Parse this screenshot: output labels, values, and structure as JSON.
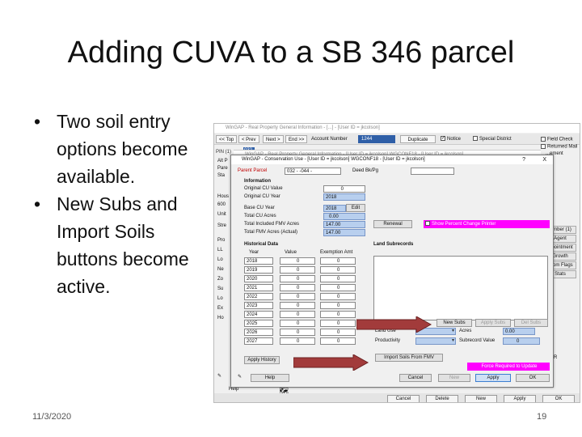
{
  "slide": {
    "title": "Adding CUVA to a SB 346 parcel",
    "bullets": [
      "Two soil entry options become available.",
      "New Subs and Import Soils buttons become active."
    ],
    "date": "11/3/2020",
    "page": "19"
  },
  "background_window": {
    "title": "WinGAP - Real Property General Information - [...] - [User ID = jkcolson]",
    "nav_top": "<< Top",
    "nav_prev": "< Prev",
    "nav_next": "Next >",
    "nav_end": "End >>",
    "account_label": "Account Number",
    "account_value": "1244",
    "duplicate_label": "Duplicate",
    "notice_label": "Notice",
    "special_district_label": "Special District",
    "field_check_label": "Field Check",
    "returned_mail_label": "Returned Mail",
    "agreement_label": "...ement",
    "pin_label": "PIN (1)",
    "pin_value": "032",
    "left_labels": [
      "Alt P",
      "Pare",
      "Sta",
      "",
      "",
      "Unit",
      "",
      "Hous",
      "600",
      "Stre",
      "",
      "Pro",
      "LL",
      "Lo",
      "Ne",
      "Zo",
      "Su",
      "Lo",
      "Ex",
      "Ho"
    ],
    "right_labels": [
      "...mber (1)",
      "Agent",
      "...pointment",
      "Growth",
      "...tom Flags",
      "Stats"
    ],
    "right_er": "ER",
    "bottom_buttons": [
      "Cancel",
      "Delete",
      "New",
      "Apply",
      "OK"
    ],
    "help_label": "Help"
  },
  "second_window": {
    "title": "WinGAP - Real Property General Information - [User ID = jkcolson] WGCONF18 - [User ID = jkcolson]"
  },
  "dialog": {
    "title": "WinGAP - Conservation Use - [User ID = jkcolson] WGCONF18 - [User ID = jkcolson]",
    "help_icon": "?",
    "close_icon": "X",
    "parent_parcel_label": "Parent Parcel",
    "parent_parcel_value": "032 - -044 -",
    "deed_label": "Deed Bk/Pg",
    "deed_value": "",
    "information_label": "Information",
    "original_cu_value_label": "Original CU Value",
    "original_cu_value": "0",
    "original_cu_year_label": "Original CU Year",
    "original_cu_year": "2018",
    "base_cu_year_label": "Base CU Year",
    "base_cu_year": "2018",
    "edit_label": "Edit",
    "total_cu_acres_label": "Total CU Acres",
    "total_cu_acres": "0.00",
    "total_included_fmv_acres_label": "Total Included FMV Acres",
    "total_included_fmv_acres": "147.00",
    "total_fmv_acres_actual_label": "Total FMV Acres (Actual)",
    "total_fmv_acres_actual": "147.00",
    "renewal_label": "Renewal",
    "show_percent_change_label": "Show Percent Change Printer",
    "historical_data_label": "Historical Data",
    "hist_year_header": "Year",
    "hist_value_header": "Value",
    "hist_exemption_header": "Exemption Amt",
    "history_rows": [
      {
        "year": "2018",
        "value": "0",
        "exemption": "0"
      },
      {
        "year": "2019",
        "value": "0",
        "exemption": "0"
      },
      {
        "year": "2020",
        "value": "0",
        "exemption": "0"
      },
      {
        "year": "2021",
        "value": "0",
        "exemption": "0"
      },
      {
        "year": "2022",
        "value": "0",
        "exemption": "0"
      },
      {
        "year": "2023",
        "value": "0",
        "exemption": "0"
      },
      {
        "year": "2024",
        "value": "0",
        "exemption": "0"
      },
      {
        "year": "2025",
        "value": "0",
        "exemption": "0"
      },
      {
        "year": "2026",
        "value": "0",
        "exemption": "0"
      },
      {
        "year": "2027",
        "value": "0",
        "exemption": "0"
      }
    ],
    "land_subrecords_label": "Land Subrecords",
    "new_subs_label": "New Subs",
    "apply_subs_label": "Apply Subs",
    "del_subs_label": "Del Subs",
    "land_use_label": "Land Use",
    "acres_label": "Acres",
    "acres_value": "0.00",
    "productivity_label": "Productivity",
    "subrecord_value_label": "Subrecord Value",
    "subrecord_value": "0",
    "apply_history_label": "Apply History",
    "import_soils_label": "Import Soils From FMV",
    "force_required_label": "Force Required to Update",
    "help_label": "Help",
    "cancel_label": "Cancel",
    "new_label": "New",
    "apply_label": "Apply",
    "ok_label": "OK"
  },
  "colors": {
    "arrow": "#a23b3b",
    "magenta": "#ff00ff",
    "field_blue": "#b8cfee"
  }
}
